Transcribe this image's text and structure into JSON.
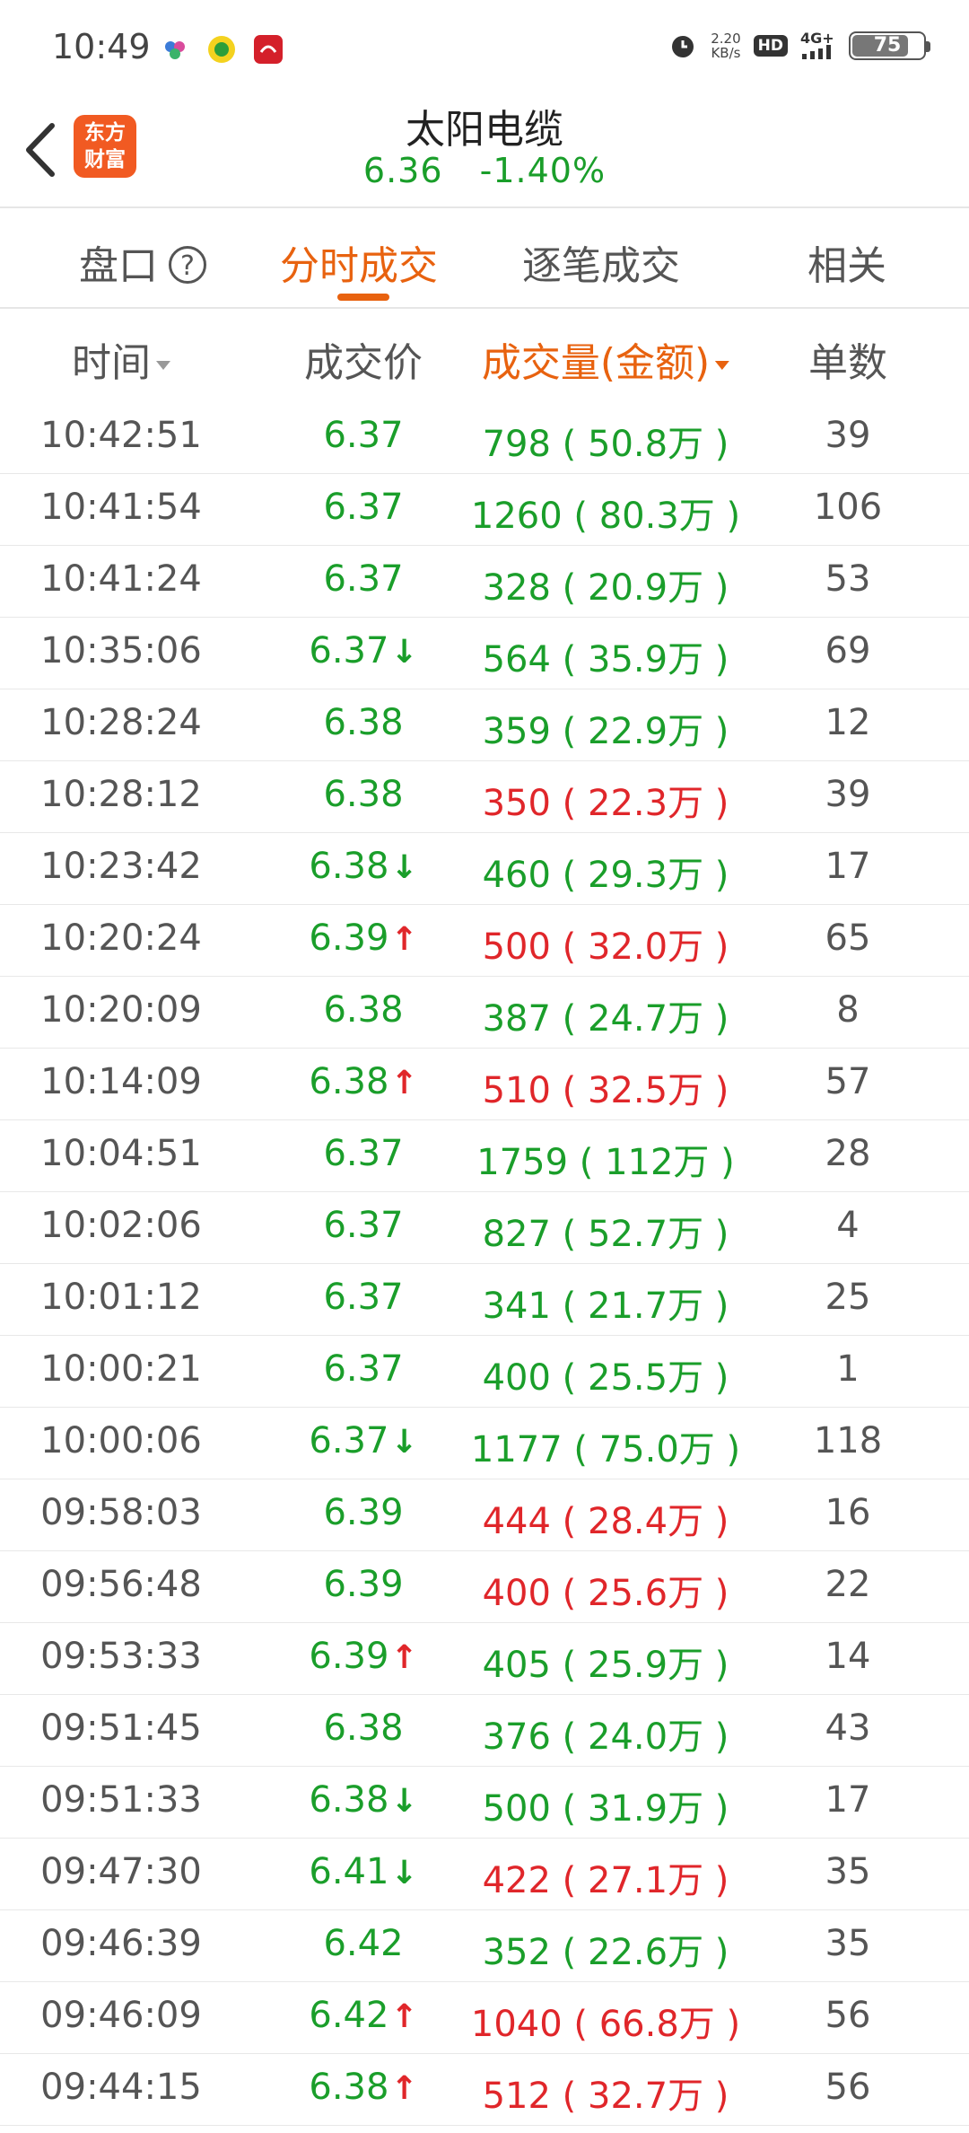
{
  "status_bar": {
    "time": "10:49",
    "speed_value": "2.20",
    "speed_unit": "KB/s",
    "hd": "HD",
    "network": "4G+",
    "battery": "75"
  },
  "header": {
    "logo_line1": "东方",
    "logo_line2": "财富",
    "title": "太阳电缆",
    "price": "6.36",
    "change": "-1.40%"
  },
  "tabs": [
    {
      "label": "盘口"
    },
    {
      "label": "分时成交"
    },
    {
      "label": "逐笔成交"
    },
    {
      "label": "相关"
    }
  ],
  "help_symbol": "?",
  "columns": {
    "time": "时间",
    "price": "成交价",
    "volume": "成交量(金额)",
    "count": "单数"
  },
  "colors": {
    "up": "#e0262a",
    "down": "#1a9e2a",
    "accent": "#e8620f"
  },
  "rows": [
    {
      "time": "10:42:51",
      "price": "6.37",
      "arrow": "",
      "volume": "798",
      "amount": "50.8万",
      "count": "39",
      "vol_color": "green"
    },
    {
      "time": "10:41:54",
      "price": "6.37",
      "arrow": "",
      "volume": "1260",
      "amount": "80.3万",
      "count": "106",
      "vol_color": "green"
    },
    {
      "time": "10:41:24",
      "price": "6.37",
      "arrow": "",
      "volume": "328",
      "amount": "20.9万",
      "count": "53",
      "vol_color": "green"
    },
    {
      "time": "10:35:06",
      "price": "6.37",
      "arrow": "down",
      "volume": "564",
      "amount": "35.9万",
      "count": "69",
      "vol_color": "green"
    },
    {
      "time": "10:28:24",
      "price": "6.38",
      "arrow": "",
      "volume": "359",
      "amount": "22.9万",
      "count": "12",
      "vol_color": "green"
    },
    {
      "time": "10:28:12",
      "price": "6.38",
      "arrow": "",
      "volume": "350",
      "amount": "22.3万",
      "count": "39",
      "vol_color": "red"
    },
    {
      "time": "10:23:42",
      "price": "6.38",
      "arrow": "down",
      "volume": "460",
      "amount": "29.3万",
      "count": "17",
      "vol_color": "green"
    },
    {
      "time": "10:20:24",
      "price": "6.39",
      "arrow": "up",
      "volume": "500",
      "amount": "32.0万",
      "count": "65",
      "vol_color": "red"
    },
    {
      "time": "10:20:09",
      "price": "6.38",
      "arrow": "",
      "volume": "387",
      "amount": "24.7万",
      "count": "8",
      "vol_color": "green"
    },
    {
      "time": "10:14:09",
      "price": "6.38",
      "arrow": "up",
      "volume": "510",
      "amount": "32.5万",
      "count": "57",
      "vol_color": "red"
    },
    {
      "time": "10:04:51",
      "price": "6.37",
      "arrow": "",
      "volume": "1759",
      "amount": "112万",
      "count": "28",
      "vol_color": "green"
    },
    {
      "time": "10:02:06",
      "price": "6.37",
      "arrow": "",
      "volume": "827",
      "amount": "52.7万",
      "count": "4",
      "vol_color": "green"
    },
    {
      "time": "10:01:12",
      "price": "6.37",
      "arrow": "",
      "volume": "341",
      "amount": "21.7万",
      "count": "25",
      "vol_color": "green"
    },
    {
      "time": "10:00:21",
      "price": "6.37",
      "arrow": "",
      "volume": "400",
      "amount": "25.5万",
      "count": "1",
      "vol_color": "green"
    },
    {
      "time": "10:00:06",
      "price": "6.37",
      "arrow": "down",
      "volume": "1177",
      "amount": "75.0万",
      "count": "118",
      "vol_color": "green"
    },
    {
      "time": "09:58:03",
      "price": "6.39",
      "arrow": "",
      "volume": "444",
      "amount": "28.4万",
      "count": "16",
      "vol_color": "red"
    },
    {
      "time": "09:56:48",
      "price": "6.39",
      "arrow": "",
      "volume": "400",
      "amount": "25.6万",
      "count": "22",
      "vol_color": "red"
    },
    {
      "time": "09:53:33",
      "price": "6.39",
      "arrow": "up",
      "volume": "405",
      "amount": "25.9万",
      "count": "14",
      "vol_color": "green"
    },
    {
      "time": "09:51:45",
      "price": "6.38",
      "arrow": "",
      "volume": "376",
      "amount": "24.0万",
      "count": "43",
      "vol_color": "green"
    },
    {
      "time": "09:51:33",
      "price": "6.38",
      "arrow": "down",
      "volume": "500",
      "amount": "31.9万",
      "count": "17",
      "vol_color": "green"
    },
    {
      "time": "09:47:30",
      "price": "6.41",
      "arrow": "down",
      "volume": "422",
      "amount": "27.1万",
      "count": "35",
      "vol_color": "red"
    },
    {
      "time": "09:46:39",
      "price": "6.42",
      "arrow": "",
      "volume": "352",
      "amount": "22.6万",
      "count": "35",
      "vol_color": "green"
    },
    {
      "time": "09:46:09",
      "price": "6.42",
      "arrow": "up",
      "volume": "1040",
      "amount": "66.8万",
      "count": "56",
      "vol_color": "red"
    },
    {
      "time": "09:44:15",
      "price": "6.38",
      "arrow": "up",
      "volume": "512",
      "amount": "32.7万",
      "count": "56",
      "vol_color": "red"
    }
  ]
}
